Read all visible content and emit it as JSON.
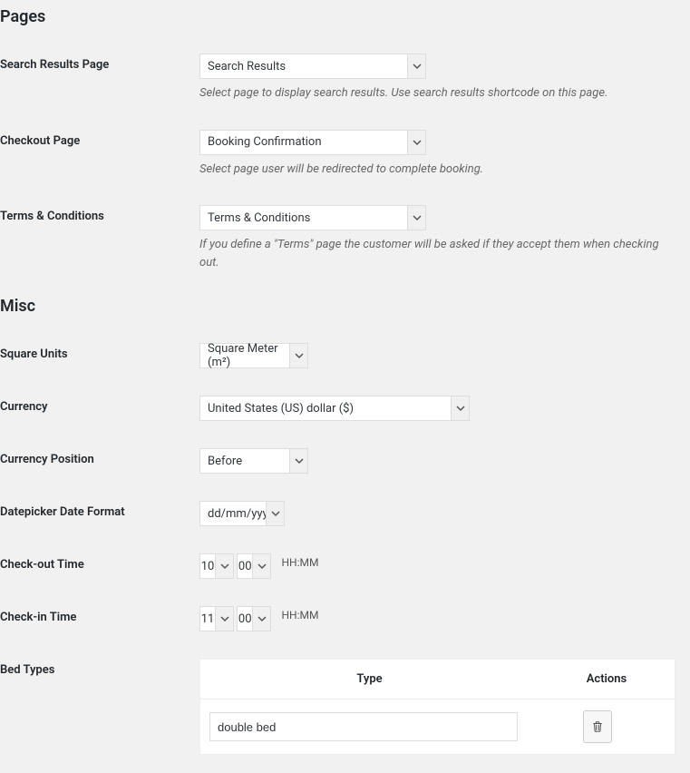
{
  "pages": {
    "heading": "Pages",
    "fields": {
      "searchResults": {
        "label": "Search Results Page",
        "value": "Search Results",
        "description": "Select page to display search results. Use search results shortcode on this page."
      },
      "checkout": {
        "label": "Checkout Page",
        "value": "Booking Confirmation",
        "description": "Select page user will be redirected to complete booking."
      },
      "terms": {
        "label": "Terms & Conditions",
        "value": "Terms & Conditions",
        "description": "If you define a \"Terms\" page the customer will be asked if they accept them when checking out."
      }
    }
  },
  "misc": {
    "heading": "Misc",
    "fields": {
      "squareUnits": {
        "label": "Square Units",
        "value": "Square Meter (m²)"
      },
      "currency": {
        "label": "Currency",
        "value": "United States (US) dollar ($)"
      },
      "currencyPosition": {
        "label": "Currency Position",
        "value": "Before"
      },
      "dateFormat": {
        "label": "Datepicker Date Format",
        "value": "dd/mm/yyyy"
      },
      "checkOut": {
        "label": "Check-out Time",
        "hh": "10",
        "mm": "00",
        "hint": "HH:MM"
      },
      "checkIn": {
        "label": "Check-in Time",
        "hh": "11",
        "mm": "00",
        "hint": "HH:MM"
      },
      "bedTypes": {
        "label": "Bed Types",
        "cols": {
          "type": "Type",
          "actions": "Actions"
        },
        "rows": [
          {
            "value": "double bed"
          }
        ]
      }
    }
  }
}
